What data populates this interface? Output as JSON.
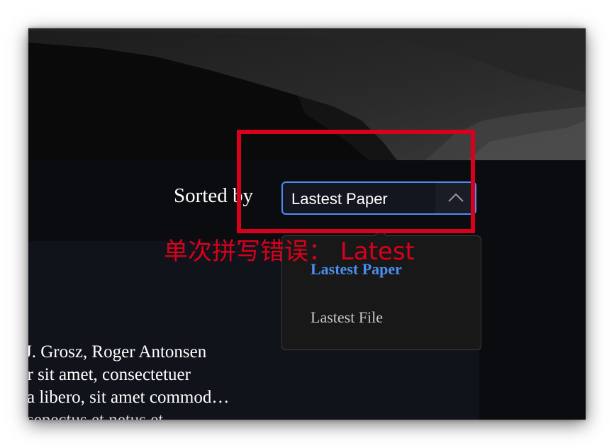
{
  "sort": {
    "label": "Sorted by",
    "selected": "Lastest Paper",
    "options": [
      "Lastest Paper",
      "Lastest File"
    ]
  },
  "annotation": {
    "text": "单次拼写错误： Latest"
  },
  "paper": {
    "authors_line": "J. Grosz, Roger Antonsen",
    "abstract_line_1": "or sit amet, consectetuer",
    "abstract_line_2": "a libero, sit amet commod…",
    "abstract_line_3": "senectus    et netus et"
  },
  "colors": {
    "accent": "#4a8ff0",
    "annotation": "#d9001b",
    "background": "#0b0c0f",
    "panel": "#10131a"
  }
}
